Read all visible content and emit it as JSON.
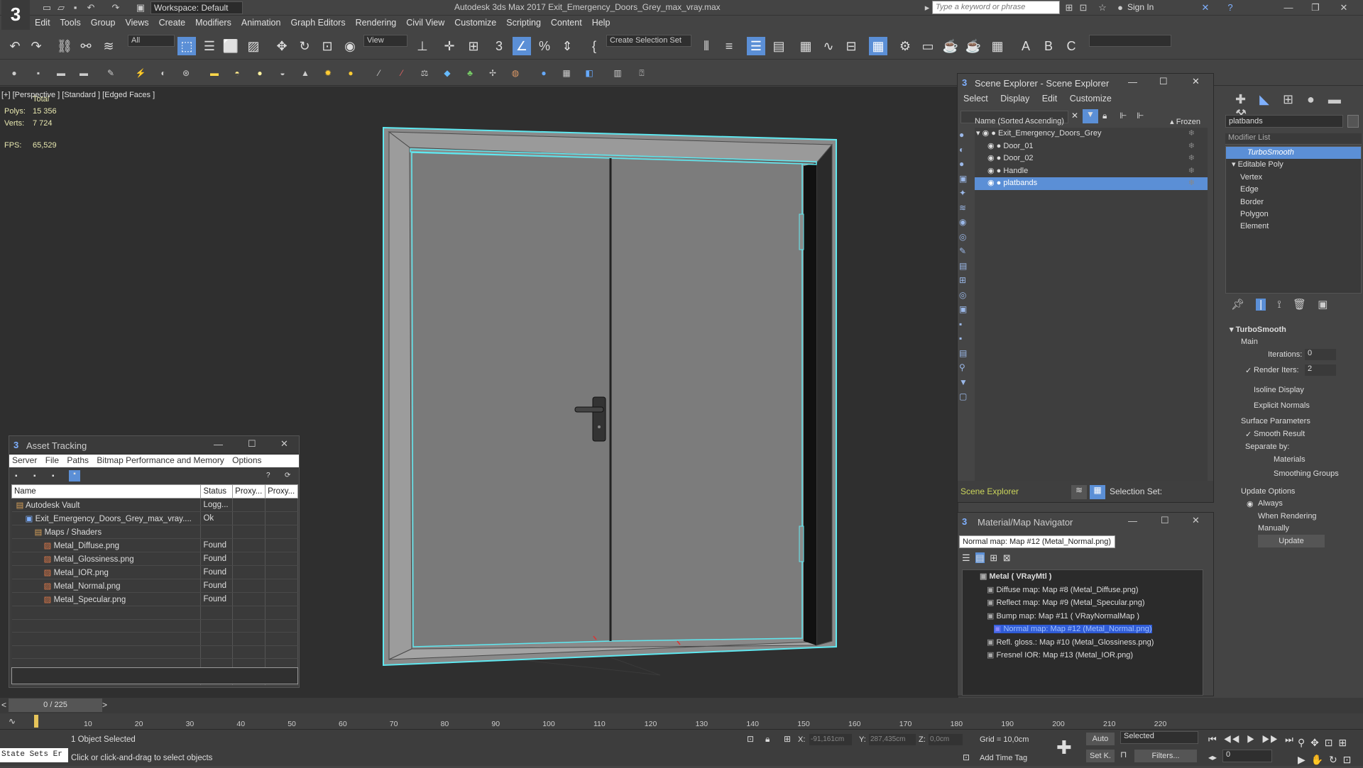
{
  "app": {
    "title": "Autodesk 3ds Max 2017    Exit_Emergency_Doors_Grey_max_vray.max",
    "logo": "3",
    "workspace": "Workspace: Default",
    "search_placeholder": "Type a keyword or phrase",
    "sign_in": "Sign In",
    "menu": [
      "Edit",
      "Tools",
      "Group",
      "Views",
      "Create",
      "Modifiers",
      "Animation",
      "Graph Editors",
      "Rendering",
      "Civil View",
      "Customize",
      "Scripting",
      "Content",
      "Help"
    ]
  },
  "toolbar": {
    "selection_filter": "All",
    "view_dropdown": "View",
    "selection_set": "Create Selection Set"
  },
  "viewport": {
    "label": "[+] [Perspective ] [Standard ] [Edged Faces ]",
    "stats_header": "Total",
    "polys_label": "Polys:",
    "polys_value": "15 356",
    "verts_label": "Verts:",
    "verts_value": "7 724",
    "fps_label": "FPS:",
    "fps_value": "65,529"
  },
  "asset_tracking": {
    "title": "Asset Tracking",
    "menu": [
      "Server",
      "File",
      "Paths",
      "Bitmap Performance and Memory",
      "Options"
    ],
    "columns": [
      "Name",
      "Status",
      "Proxy...",
      "Proxy..."
    ],
    "rows": [
      {
        "name": "Autodesk Vault",
        "status": "Logg...",
        "indent": 0
      },
      {
        "name": "Exit_Emergency_Doors_Grey_max_vray....",
        "status": "Ok",
        "indent": 1
      },
      {
        "name": "Maps / Shaders",
        "status": "",
        "indent": 2
      },
      {
        "name": "Metal_Diffuse.png",
        "status": "Found",
        "indent": 3
      },
      {
        "name": "Metal_Glossiness.png",
        "status": "Found",
        "indent": 3
      },
      {
        "name": "Metal_IOR.png",
        "status": "Found",
        "indent": 3
      },
      {
        "name": "Metal_Normal.png",
        "status": "Found",
        "indent": 3
      },
      {
        "name": "Metal_Specular.png",
        "status": "Found",
        "indent": 3
      }
    ]
  },
  "scene_explorer": {
    "title": "Scene Explorer - Scene Explorer",
    "menu": [
      "Select",
      "Display",
      "Edit",
      "Customize"
    ],
    "col_name": "Name (Sorted Ascending)",
    "col_frozen": "Frozen",
    "items": [
      {
        "name": "Exit_Emergency_Doors_Grey",
        "level": 0,
        "selected": false
      },
      {
        "name": "Door_01",
        "level": 1,
        "selected": false
      },
      {
        "name": "Door_02",
        "level": 1,
        "selected": false
      },
      {
        "name": "Handle",
        "level": 1,
        "selected": false
      },
      {
        "name": "platbands",
        "level": 1,
        "selected": true
      }
    ],
    "footer_label": "Scene Explorer",
    "selection_set_label": "Selection Set:"
  },
  "modify_panel": {
    "object_name": "platbands",
    "modifier_list": "Modifier List",
    "stack": [
      {
        "name": "TurboSmooth",
        "selected": true,
        "level": 0
      },
      {
        "name": "Editable Poly",
        "selected": false,
        "level": 0
      },
      {
        "name": "Vertex",
        "selected": false,
        "level": 1
      },
      {
        "name": "Edge",
        "selected": false,
        "level": 1
      },
      {
        "name": "Border",
        "selected": false,
        "level": 1
      },
      {
        "name": "Polygon",
        "selected": false,
        "level": 1
      },
      {
        "name": "Element",
        "selected": false,
        "level": 1
      }
    ],
    "rollout_title": "TurboSmooth",
    "main": "Main",
    "iterations_label": "Iterations:",
    "iterations_value": "0",
    "render_iters_label": "Render Iters:",
    "render_iters_value": "2",
    "isoline": "Isoline Display",
    "explicit_normals": "Explicit Normals",
    "surface_params": "Surface Parameters",
    "smooth_result": "Smooth Result",
    "separate_by": "Separate by:",
    "materials": "Materials",
    "smoothing_groups": "Smoothing Groups",
    "update_options": "Update Options",
    "always": "Always",
    "when_rendering": "When Rendering",
    "manually": "Manually",
    "update_button": "Update"
  },
  "material_navigator": {
    "title": "Material/Map Navigator",
    "path": "Normal map: Map #12 (Metal_Normal.png)",
    "items": [
      {
        "text": "Metal  ( VRayMtl )",
        "level": 0,
        "bold": true,
        "selected": false
      },
      {
        "text": "Diffuse map: Map #8 (Metal_Diffuse.png)",
        "level": 1,
        "selected": false
      },
      {
        "text": "Reflect map: Map #9 (Metal_Specular.png)",
        "level": 1,
        "selected": false
      },
      {
        "text": "Bump map: Map #11  ( VRayNormalMap )",
        "level": 1,
        "selected": false
      },
      {
        "text": "Normal map: Map #12 (Metal_Normal.png)",
        "level": 2,
        "selected": true
      },
      {
        "text": "Refl. gloss.: Map #10 (Metal_Glossiness.png)",
        "level": 1,
        "selected": false
      },
      {
        "text": "Fresnel IOR: Map #13 (Metal_IOR.png)",
        "level": 1,
        "selected": false
      }
    ]
  },
  "timeline": {
    "frame": "0 / 225",
    "ticks": [
      "10",
      "20",
      "30",
      "40",
      "50",
      "60",
      "70",
      "80",
      "90",
      "100",
      "110",
      "120",
      "130",
      "140",
      "150",
      "160",
      "170",
      "180",
      "190",
      "200",
      "210",
      "220"
    ]
  },
  "status": {
    "state_sets": "State Sets Er",
    "selected": "1 Object Selected",
    "prompt": "Click or click-and-drag to select objects",
    "x_label": "X:",
    "x_value": "-91,161cm",
    "y_label": "Y:",
    "y_value": "287,435cm",
    "z_label": "Z:",
    "z_value": "0,0cm",
    "grid": "Grid = 10,0cm",
    "add_time_tag": "Add Time Tag",
    "auto": "Auto",
    "selected_dd": "Selected",
    "set_key": "Set K.",
    "filters": "Filters...",
    "frame_value": "0"
  },
  "colors": {
    "accent": "#5b8fd6",
    "selection_cyan": "#5fe8f0"
  }
}
